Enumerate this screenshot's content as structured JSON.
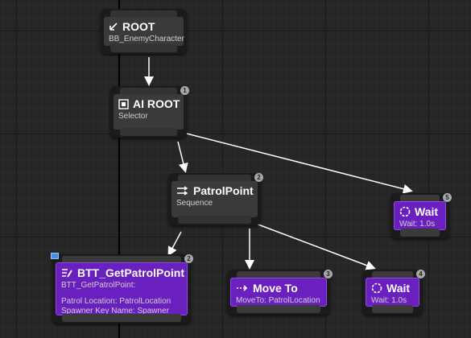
{
  "nodes": {
    "root": {
      "title": "ROOT",
      "sub": "BB_EnemyCharacter",
      "icon": "root-icon"
    },
    "ai_root": {
      "title": "AI ROOT",
      "sub": "Selector",
      "badge": "1",
      "icon": "selector-icon"
    },
    "patrol_point": {
      "title": "PatrolPoint",
      "sub": "Sequence",
      "badge": "2",
      "icon": "sequence-icon"
    },
    "wait5": {
      "title": "Wait",
      "sub": "Wait: 1.0s",
      "badge": "5",
      "icon": "wait-icon"
    },
    "btt": {
      "title": "BTT_GetPatrolPoint",
      "sub": "BTT_GetPatrolPoint:",
      "line1": "Patrol Location: PatrolLocation",
      "line2": "Spawner Key Name: Spawner",
      "badge": "2",
      "icon": "blueprint-task-icon"
    },
    "move_to": {
      "title": "Move To",
      "sub": "MoveTo: PatrolLocation",
      "badge": "3",
      "icon": "move-to-icon"
    },
    "wait4": {
      "title": "Wait",
      "sub": "Wait: 1.0s",
      "badge": "4",
      "icon": "wait-icon"
    }
  },
  "colors": {
    "task": "#6a1fbf",
    "composite": "#3a3a3a",
    "background": "#262626"
  }
}
